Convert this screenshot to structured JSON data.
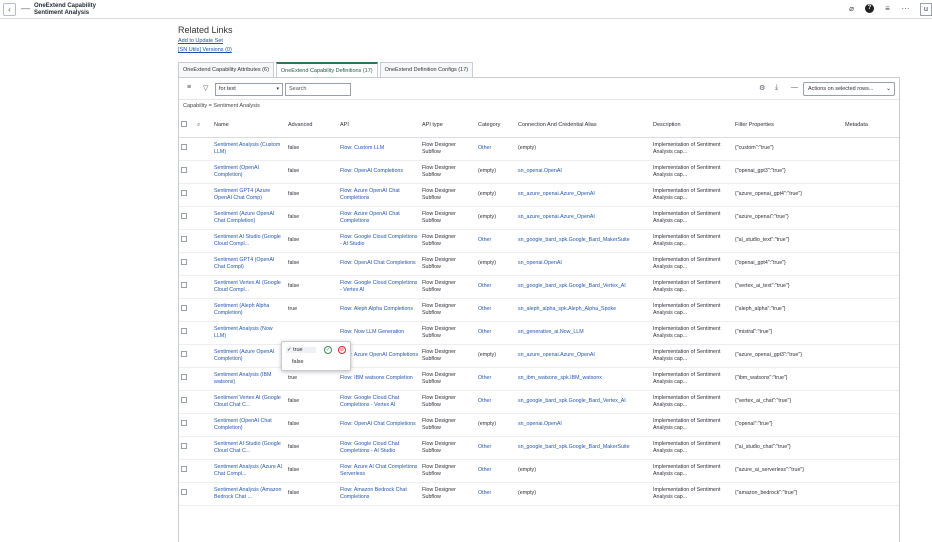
{
  "header": {
    "back_icon": "‹",
    "minus_icon": "—",
    "title_line1": "OneExtend Capability",
    "title_line2": "Sentiment Analysis",
    "right_button": "u"
  },
  "related": {
    "heading": "Related Links",
    "links": [
      "Add to Update Set",
      "[SN Utils] Versions (0)"
    ]
  },
  "tabs": [
    {
      "label": "OneExtend Capability Attributes (6)"
    },
    {
      "label": "OneExtend Capability Definitions (17)"
    },
    {
      "label": "OneExtend Definition Configs (17)"
    }
  ],
  "toolbar": {
    "for_select": "for text",
    "search_placeholder": "Search",
    "actions_select": "Actions on selected rows..."
  },
  "breadcrumb": "Capability = Sentiment Analysis",
  "columns": [
    "Name",
    "Advanced",
    "API",
    "API type",
    "Category",
    "Connection And Credential Alias",
    "Description",
    "Filter Properties",
    "Metadata"
  ],
  "rows": [
    {
      "name": "Sentiment Analysis (Custom LLM)",
      "advanced": "false",
      "api": "Flow: Custom LLM",
      "api_type": "Flow Designer Subflow",
      "category": "Other",
      "alias": "(empty)",
      "description": "Implementation of Sentiment Analysis cap...",
      "filter": "{\"custom\":\"true\"}"
    },
    {
      "name": "Sentiment (OpenAI Completion)",
      "advanced": "false",
      "api": "Flow: OpenAI Completions",
      "api_type": "Flow Designer Subflow",
      "category": "(empty)",
      "alias": "sn_openai.OpenAI",
      "description": "Implementation of Sentiment Analysis cap...",
      "filter": "{\"openai_gpt3\":\"true\"}"
    },
    {
      "name": "Sentiment GPT4 (Azure OpenAI Chat Comp)",
      "advanced": "false",
      "api": "Flow: Azure OpenAI Chat Completions",
      "api_type": "Flow Designer Subflow",
      "category": "(empty)",
      "alias": "sn_azure_openai.Azure_OpenAI",
      "description": "Implementation of Sentiment Analysis cap...",
      "filter": "{\"azure_openai_gpt4\":\"true\"}"
    },
    {
      "name": "Sentiment (Azure OpenAI Chat Completion)",
      "advanced": "false",
      "api": "Flow: Azure OpenAI Chat Completions",
      "api_type": "Flow Designer Subflow",
      "category": "(empty)",
      "alias": "sn_azure_openai.Azure_OpenAI",
      "description": "Implementation of Sentiment Analysis cap...",
      "filter": "{\"azure_openai\":\"true\"}"
    },
    {
      "name": "Sentiment AI Studio (Google Cloud Compl...",
      "advanced": "false",
      "api": "Flow: Google Cloud Completions - AI Studio",
      "api_type": "Flow Designer Subflow",
      "category": "Other",
      "alias": "sn_google_bard_spk.Google_Bard_MakerSuite",
      "description": "Implementation of Sentiment Analysis cap...",
      "filter": "{\"ai_studio_text\":\"true\"}"
    },
    {
      "name": "Sentiment GPT4 (OpenAI Chat Compl)",
      "advanced": "false",
      "api": "Flow: OpenAI Chat Completions",
      "api_type": "Flow Designer Subflow",
      "category": "(empty)",
      "alias": "sn_openai.OpenAI",
      "description": "Implementation of Sentiment Analysis cap...",
      "filter": "{\"openai_gpt4\":\"true\"}"
    },
    {
      "name": "Sentiment Vertex AI (Google Cloud Compl...",
      "advanced": "false",
      "api": "Flow: Google Cloud Completions - Vertex AI",
      "api_type": "Flow Designer Subflow",
      "category": "Other",
      "alias": "sn_google_bard_spk.Google_Bard_Vertex_AI",
      "description": "Implementation of Sentiment Analysis cap...",
      "filter": "{\"vertex_ai_text\":\"true\"}"
    },
    {
      "name": "Sentiment (Aleph Alpha Completion)",
      "advanced": "true",
      "api": "Flow: Aleph Alpha Completions",
      "api_type": "Flow Designer Subflow",
      "category": "Other",
      "alias": "sn_aleph_alpha_spk.Aleph_Alpha_Spoke",
      "description": "Implementation of Sentiment Analysis cap...",
      "filter": "{\"aleph_alpha\":\"true\"}"
    },
    {
      "name": "Sentiment Analysis (Now LLM)",
      "advanced": "",
      "api": "Flow: Now LLM Generation",
      "api_type": "Flow Designer Subflow",
      "category": "Other",
      "alias": "sn_generative_ai.Now_LLM",
      "description": "Implementation of Sentiment Analysis cap...",
      "filter": "{\"mistral\":\"true\"}"
    },
    {
      "name": "Sentiment (Azure OpenAI Completion)",
      "advanced": "false",
      "api": "Flow: Azure OpenAI Completions",
      "api_type": "Flow Designer Subflow",
      "category": "(empty)",
      "alias": "sn_azure_openai.Azure_OpenAI",
      "description": "Implementation of Sentiment Analysis cap...",
      "filter": "{\"azure_openai_gpt3\":\"true\"}"
    },
    {
      "name": "Sentiment Analysis (IBM watsonx)",
      "advanced": "true",
      "api": "Flow: IBM watsonx Completion",
      "api_type": "Flow Designer Subflow",
      "category": "Other",
      "alias": "sn_ibm_watsonx_spk.IBM_watsonx",
      "description": "Implementation of Sentiment Analysis cap...",
      "filter": "{\"ibm_watsonx\":\"true\"}"
    },
    {
      "name": "Sentiment Vertex AI (Google Cloud Chat C...",
      "advanced": "false",
      "api": "Flow: Google Cloud Chat Completions - Vertex AI",
      "api_type": "Flow Designer Subflow",
      "category": "Other",
      "alias": "sn_google_bard_spk.Google_Bard_Vertex_AI",
      "description": "Implementation of Sentiment Analysis cap...",
      "filter": "{\"vertex_ai_chat\":\"true\"}"
    },
    {
      "name": "Sentiment (OpenAI Chat Completion)",
      "advanced": "false",
      "api": "Flow: OpenAI Chat Completions",
      "api_type": "Flow Designer Subflow",
      "category": "(empty)",
      "alias": "sn_openai.OpenAI",
      "description": "Implementation of Sentiment Analysis cap...",
      "filter": "{\"openai\":\"true\"}"
    },
    {
      "name": "Sentiment AI Studio (Google Cloud Chat C...",
      "advanced": "false",
      "api": "Flow: Google Cloud Chat Completions - AI Studio",
      "api_type": "Flow Designer Subflow",
      "category": "Other",
      "alias": "sn_google_bard_spk.Google_Bard_MakerSuite",
      "description": "Implementation of Sentiment Analysis cap...",
      "filter": "{\"ai_studio_chat\":\"true\"}"
    },
    {
      "name": "Sentiment Analysis (Azure AI Chat Compl...",
      "advanced": "false",
      "api": "Flow: Azure AI Chat Completions Serverless",
      "api_type": "Flow Designer Subflow",
      "category": "Other",
      "alias": "(empty)",
      "description": "Implementation of Sentiment Analysis cap...",
      "filter": "{\"azure_ai_serverless\":\"true\"}"
    },
    {
      "name": "Sentiment Analysis (Amazon Bedrock Chat ...",
      "advanced": "false",
      "api": "Flow: Amazon Bedrock Chat Completions",
      "api_type": "Flow Designer Subflow",
      "category": "Other",
      "alias": "(empty)",
      "description": "Implementation of Sentiment Analysis cap...",
      "filter": "{\"amazon_bedrock\":\"true\"}"
    }
  ],
  "popup": {
    "selected": "✓ true",
    "other": "false",
    "ok_icon": "✓",
    "cancel_icon": "⊘"
  }
}
